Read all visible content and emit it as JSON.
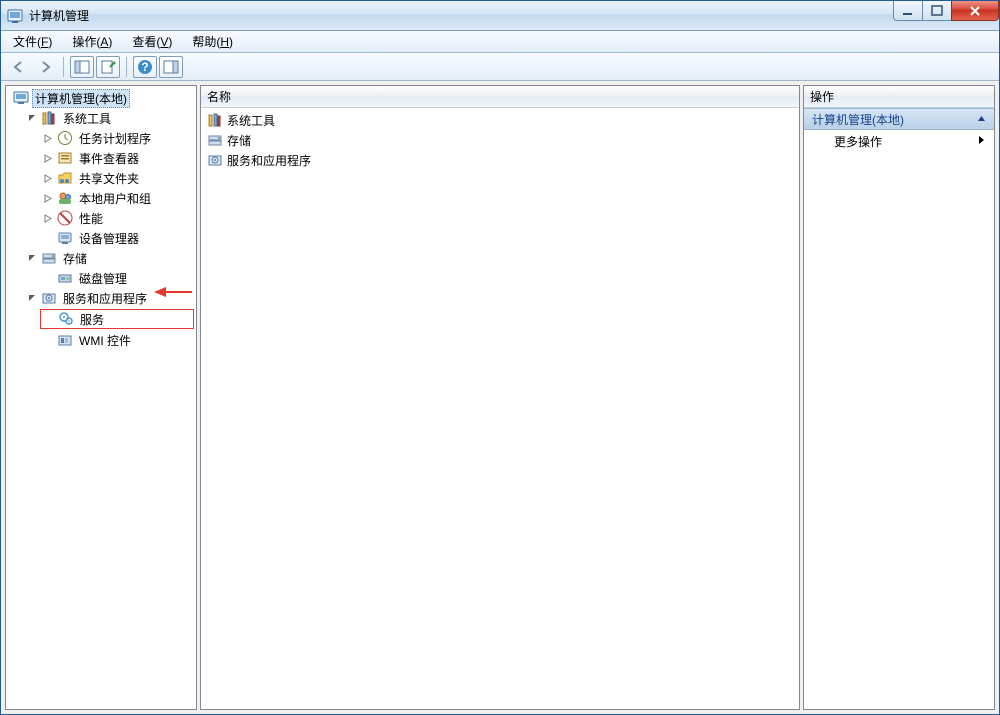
{
  "window": {
    "title": "计算机管理"
  },
  "menubar": {
    "file": "文件(F)",
    "action": "操作(A)",
    "view": "查看(V)",
    "help": "帮助(H)"
  },
  "tree": {
    "root": "计算机管理(本地)",
    "system_tools": "系统工具",
    "task_scheduler": "任务计划程序",
    "event_viewer": "事件查看器",
    "shared_folders": "共享文件夹",
    "local_users_groups": "本地用户和组",
    "performance": "性能",
    "device_manager": "设备管理器",
    "storage": "存储",
    "disk_management": "磁盘管理",
    "services_apps": "服务和应用程序",
    "services": "服务",
    "wmi_control": "WMI 控件"
  },
  "list": {
    "column_name": "名称",
    "items": {
      "system_tools": "系统工具",
      "storage": "存储",
      "services_apps": "服务和应用程序"
    }
  },
  "actions": {
    "header": "操作",
    "group": "计算机管理(本地)",
    "more_actions": "更多操作"
  }
}
